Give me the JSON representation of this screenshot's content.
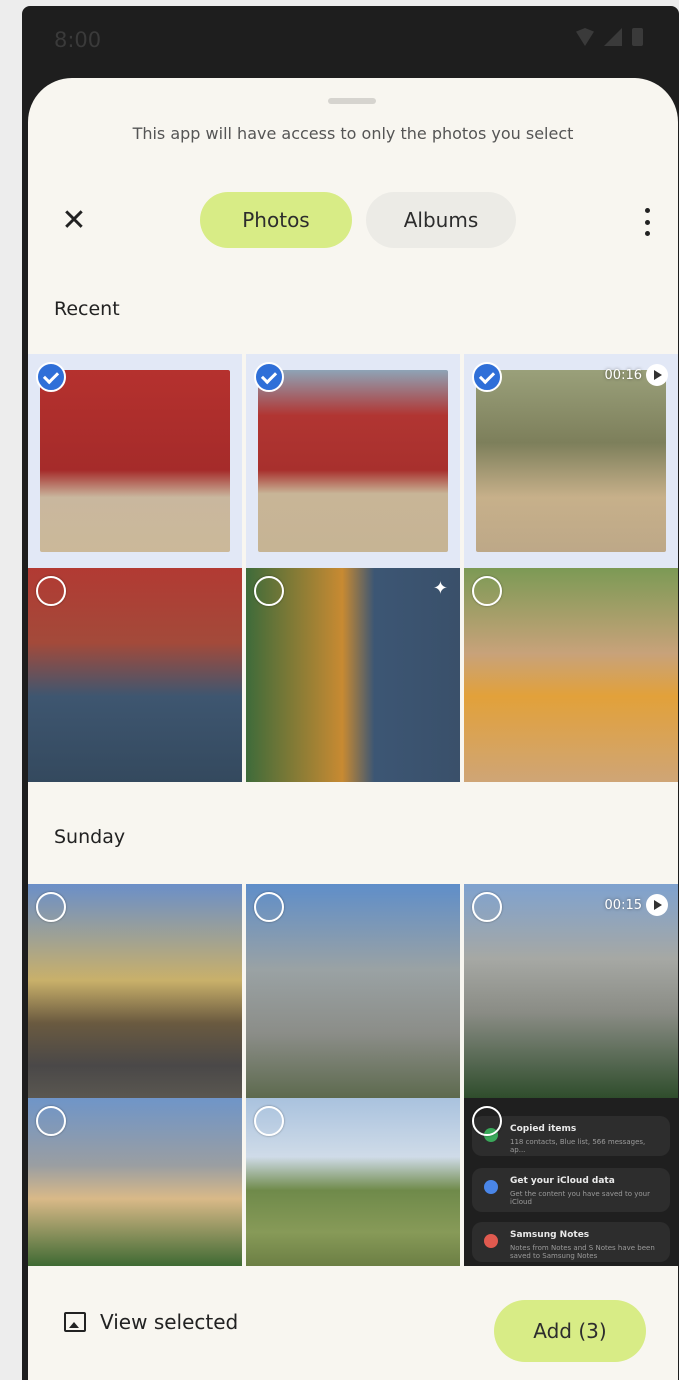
{
  "status_bar": {
    "time": "8:00"
  },
  "sheet": {
    "notice": "This app will have access to only the photos you select",
    "tabs": [
      {
        "label": "Photos",
        "active": true
      },
      {
        "label": "Albums",
        "active": false
      }
    ]
  },
  "sections": [
    {
      "title": "Recent",
      "items": [
        {
          "selected": true,
          "badge": ""
        },
        {
          "selected": true,
          "badge": ""
        },
        {
          "selected": true,
          "badge": "00:16"
        },
        {
          "selected": false,
          "badge": ""
        },
        {
          "selected": false,
          "badge": "sparkle"
        },
        {
          "selected": false,
          "badge": ""
        }
      ]
    },
    {
      "title": "Sunday",
      "items": [
        {
          "selected": false,
          "badge": ""
        },
        {
          "selected": false,
          "badge": ""
        },
        {
          "selected": false,
          "badge": "00:15"
        },
        {
          "selected": false,
          "badge": ""
        },
        {
          "selected": false,
          "badge": ""
        },
        {
          "selected": false,
          "badge": ""
        }
      ]
    }
  ],
  "screenshot_cards": [
    {
      "title": "Copied items",
      "subtitle": "118 contacts, Blue list, 566 messages, ap..."
    },
    {
      "title": "Get your iCloud data",
      "subtitle": "Get the content you have saved to your iCloud"
    },
    {
      "title": "Samsung Notes",
      "subtitle": "Notes from Notes and S Notes have been saved to Samsung Notes"
    }
  ],
  "bottom_bar": {
    "view_selected": "View selected",
    "add_button": "Add (3)"
  },
  "colors": {
    "accent_green": "#d8ec86",
    "selection_blue": "#2f6fd8",
    "sheet_bg": "#f8f6f0"
  }
}
